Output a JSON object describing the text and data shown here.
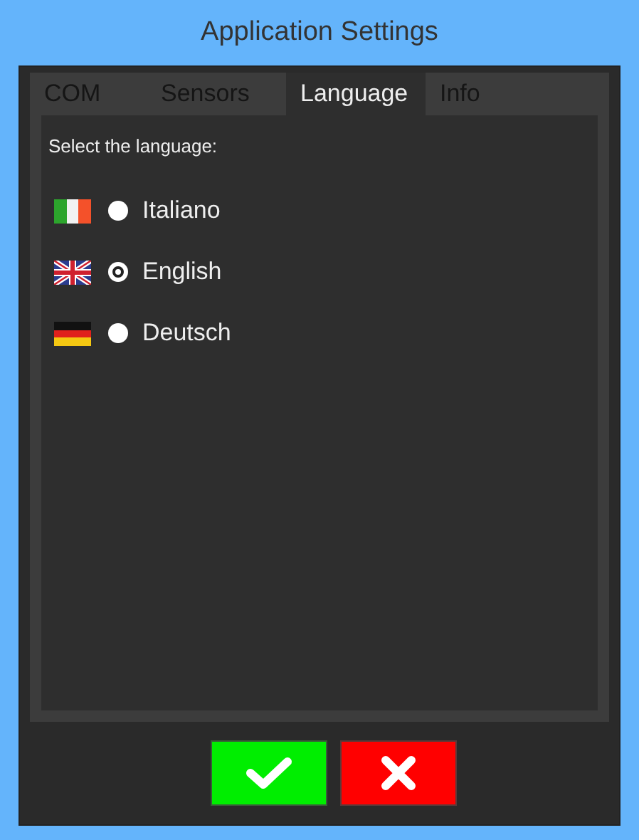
{
  "window": {
    "title": "Application Settings"
  },
  "tabs": [
    {
      "label": "COM",
      "selected": false
    },
    {
      "label": "Sensors",
      "selected": false
    },
    {
      "label": "Language",
      "selected": true
    },
    {
      "label": "Info",
      "selected": false
    }
  ],
  "prompt": "Select the language:",
  "languages": [
    {
      "kind": "italy",
      "label": "Italiano",
      "selected": false
    },
    {
      "kind": "uk",
      "label": "English",
      "selected": true
    },
    {
      "kind": "germany",
      "label": "Deutsch",
      "selected": false
    }
  ],
  "buttons": [
    {
      "kind": "confirm"
    },
    {
      "kind": "cancel"
    }
  ]
}
